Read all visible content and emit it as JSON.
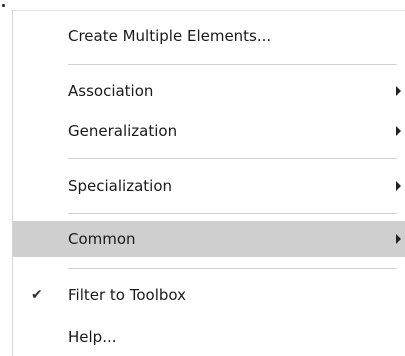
{
  "menu": {
    "items": [
      {
        "label": "Create Multiple Elements..."
      },
      {
        "label": "Association"
      },
      {
        "label": "Generalization"
      },
      {
        "label": "Specialization"
      },
      {
        "label": "Common"
      },
      {
        "label": "Filter to Toolbox",
        "checkmark": "✔",
        "checked": true
      },
      {
        "label": "Help..."
      }
    ]
  },
  "colors": {
    "highlight": "#cfcfcf",
    "separator": "#d2d2d2",
    "text": "#1a1a1a"
  },
  "icons": {
    "submenu_arrow": "chevron-right-icon",
    "check": "checkmark-icon"
  }
}
